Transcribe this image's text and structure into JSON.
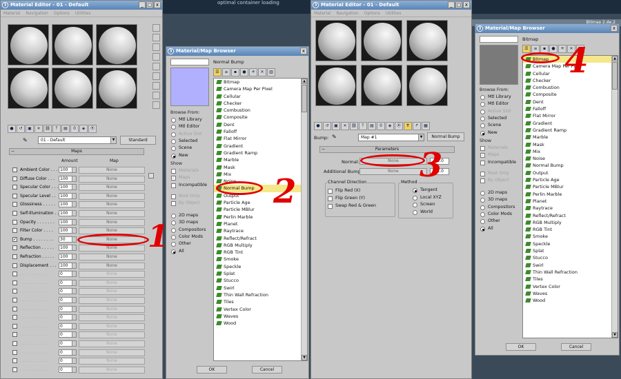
{
  "background": {
    "title_text": "optimal container loading",
    "right_text": "Bitmap 2.de.2"
  },
  "win1": {
    "title": "Material Editor - 01 - Default",
    "menus": [
      "Material",
      "Navigation",
      "Options",
      "Utilities"
    ],
    "material_name": "01 - Default",
    "type_button": "Standard",
    "rollout": "Maps",
    "col_amount": "Amount",
    "col_map": "Map",
    "maps": [
      {
        "label": "Ambient Color . . .",
        "amount": "100",
        "map": "None",
        "checked": false,
        "enabled": true
      },
      {
        "label": "Diffuse Color . . .",
        "amount": "100",
        "map": "None",
        "checked": false,
        "enabled": true
      },
      {
        "label": "Specular Color . . .",
        "amount": "100",
        "map": "None",
        "checked": false,
        "enabled": true
      },
      {
        "label": "Specular Level . .",
        "amount": "100",
        "map": "None",
        "checked": false,
        "enabled": true
      },
      {
        "label": "Glossiness . . . . .",
        "amount": "100",
        "map": "None",
        "checked": false,
        "enabled": true
      },
      {
        "label": "Self-Illumination . .",
        "amount": "100",
        "map": "None",
        "checked": false,
        "enabled": true
      },
      {
        "label": "Opacity . . . . . . .",
        "amount": "100",
        "map": "None",
        "checked": false,
        "enabled": true
      },
      {
        "label": "Filter Color . . . .",
        "amount": "100",
        "map": "None",
        "checked": false,
        "enabled": true
      },
      {
        "label": "Bump . . . . . . . .",
        "amount": "30",
        "map": "None",
        "checked": true,
        "enabled": true
      },
      {
        "label": "Reflection . . . . .",
        "amount": "100",
        "map": "None",
        "checked": false,
        "enabled": true
      },
      {
        "label": "Refraction . . . . .",
        "amount": "100",
        "map": "None",
        "checked": false,
        "enabled": true
      },
      {
        "label": "Displacement . . .",
        "amount": "100",
        "map": "None",
        "checked": false,
        "enabled": true
      },
      {
        "label": ". . . . . . . . . . . .",
        "amount": "0",
        "map": "None",
        "checked": false,
        "enabled": false
      },
      {
        "label": ". . . . . . . . . . . .",
        "amount": "0",
        "map": "None",
        "checked": false,
        "enabled": false
      },
      {
        "label": ". . . . . . . . . . . .",
        "amount": "0",
        "map": "None",
        "checked": false,
        "enabled": false
      },
      {
        "label": ". . . . . . . . . . . .",
        "amount": "0",
        "map": "None",
        "checked": false,
        "enabled": false
      },
      {
        "label": ". . . . . . . . . . . .",
        "amount": "0",
        "map": "None",
        "checked": false,
        "enabled": false
      },
      {
        "label": ". . . . . . . . . . . .",
        "amount": "0",
        "map": "None",
        "checked": false,
        "enabled": false
      },
      {
        "label": ". . . . . . . . . . . .",
        "amount": "0",
        "map": "None",
        "checked": false,
        "enabled": false
      },
      {
        "label": ". . . . . . . . . . . .",
        "amount": "0",
        "map": "None",
        "checked": false,
        "enabled": false
      },
      {
        "label": ". . . . . . . . . . . .",
        "amount": "0",
        "map": "None",
        "checked": false,
        "enabled": false
      },
      {
        "label": ". . . . . . . . . . . .",
        "amount": "0",
        "map": "None",
        "checked": false,
        "enabled": false
      },
      {
        "label": ". . . . . . . . . . . .",
        "amount": "0",
        "map": "None",
        "checked": false,
        "enabled": false
      },
      {
        "label": ". . . . . . . . . . . .",
        "amount": "0",
        "map": "None",
        "checked": false,
        "enabled": false
      }
    ]
  },
  "browser1": {
    "title": "Material/Map Browser",
    "selected_name": "Normal Bump",
    "browse_from_label": "Browse From:",
    "browse_from": [
      "Mtl Library",
      "Mtl Editor",
      "Active Slot",
      "Selected",
      "Scene",
      "New"
    ],
    "show_label": "Show",
    "show": [
      "Materials",
      "Maps",
      "Incompatible"
    ],
    "root_only": "Root Only",
    "by_object": "By Object",
    "types": [
      "2D maps",
      "3D maps",
      "Compositors",
      "Color Mods",
      "Other",
      "All"
    ],
    "items": [
      "Bitmap",
      "Camera Map Per Pixel",
      "Cellular",
      "Checker",
      "Combustion",
      "Composite",
      "Dent",
      "Falloff",
      "Flat Mirror",
      "Gradient",
      "Gradient Ramp",
      "Marble",
      "Mask",
      "Mix",
      "Noise",
      "Normal Bump",
      "Output",
      "Particle Age",
      "Particle MBlur",
      "Perlin Marble",
      "Planet",
      "Raytrace",
      "Reflect/Refract",
      "RGB Multiply",
      "RGB Tint",
      "Smoke",
      "Speckle",
      "Splat",
      "Stucco",
      "Swirl",
      "Thin Wall Refraction",
      "Tiles",
      "Vertex Color",
      "Waves",
      "Wood"
    ],
    "ok": "OK",
    "cancel": "Cancel"
  },
  "win3": {
    "title": "Material Editor - 01 - Default",
    "menus": [
      "Material",
      "Navigation",
      "Options",
      "Utilities"
    ],
    "bump_label": "Bump:",
    "map_name": "Map #1",
    "type_button": "Normal Bump",
    "rollout": "Parameters",
    "normal_label": "Normal:",
    "normal_map": "None",
    "normal_value": "1.0",
    "additional_label": "Additional Bump:",
    "additional_map": "None",
    "additional_value": "1.0",
    "channel_direction": "Channel Direction",
    "flip_red": "Flip Red (X)",
    "flip_green": "Flip Green (Y)",
    "swap": "Swap Red & Green",
    "method": "Method",
    "methods": [
      "Tangent",
      "Local XYZ",
      "Screen",
      "World"
    ]
  },
  "browser2": {
    "title": "Material/Map Browser",
    "selected_name": "Bitmap",
    "browse_from_label": "Browse From:",
    "browse_from": [
      "Mtl Library",
      "Mtl Editor",
      "Active Slot",
      "Selected",
      "Scene",
      "New"
    ],
    "show_label": "Show",
    "show": [
      "Materials",
      "Maps",
      "Incompatible"
    ],
    "root_only": "Root Only",
    "by_object": "By Object",
    "types": [
      "2D maps",
      "3D maps",
      "Compositors",
      "Color Mods",
      "Other",
      "All"
    ],
    "items": [
      "Bitmap",
      "Camera Map Per Pixel",
      "Cellular",
      "Checker",
      "Combustion",
      "Composite",
      "Dent",
      "Falloff",
      "Flat Mirror",
      "Gradient",
      "Gradient Ramp",
      "Marble",
      "Mask",
      "Mix",
      "Noise",
      "Normal Bump",
      "Output",
      "Particle Age",
      "Particle MBlur",
      "Perlin Marble",
      "Planet",
      "Raytrace",
      "Reflect/Refract",
      "RGB Multiply",
      "RGB Tint",
      "Smoke",
      "Speckle",
      "Splat",
      "Stucco",
      "Swirl",
      "Thin Wall Refraction",
      "Tiles",
      "Vertex Color",
      "Waves",
      "Wood"
    ],
    "ok": "OK",
    "cancel": "Cancel"
  },
  "annotations": [
    "1",
    "2",
    "3",
    "4"
  ],
  "colors": {
    "annotation": "#e00000",
    "highlight": "#f6e88a",
    "swatch1": "#b0b0ff",
    "swatch2": "#7a7a7a",
    "map_icon": "#3c8c2c"
  }
}
